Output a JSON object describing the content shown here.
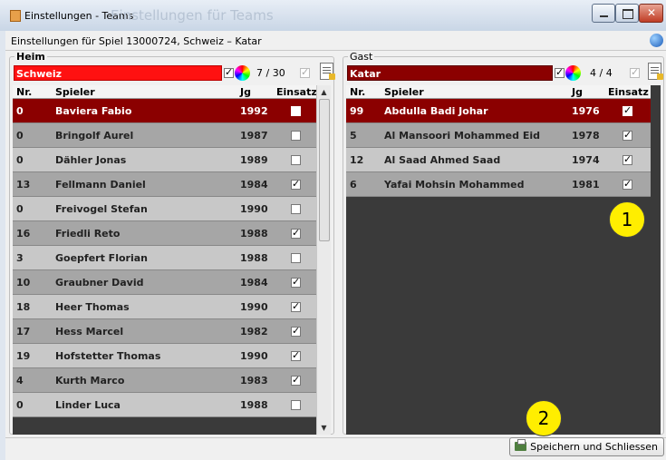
{
  "window": {
    "title": "Einstellungen - Teams",
    "ghost_title": "Einstellungen für Teams"
  },
  "subtitle": "Einstellungen für Spiel 13000724, Schweiz – Katar",
  "home": {
    "legend": "Heim",
    "team": "Schweiz",
    "team_color": "#ff1111",
    "count": "7 / 30",
    "columns": [
      "Nr.",
      "Spieler",
      "Jg",
      "Einsatz"
    ],
    "players": [
      {
        "nr": "0",
        "name": "Baviera Fabio",
        "jg": "1992",
        "einsatz": false,
        "selected": true
      },
      {
        "nr": "0",
        "name": "Bringolf Aurel",
        "jg": "1987",
        "einsatz": false
      },
      {
        "nr": "0",
        "name": "Dähler Jonas",
        "jg": "1989",
        "einsatz": false
      },
      {
        "nr": "13",
        "name": "Fellmann Daniel",
        "jg": "1984",
        "einsatz": true
      },
      {
        "nr": "0",
        "name": "Freivogel Stefan",
        "jg": "1990",
        "einsatz": false
      },
      {
        "nr": "16",
        "name": "Friedli Reto",
        "jg": "1988",
        "einsatz": true
      },
      {
        "nr": "3",
        "name": "Goepfert Florian",
        "jg": "1988",
        "einsatz": false
      },
      {
        "nr": "10",
        "name": "Graubner David",
        "jg": "1984",
        "einsatz": true
      },
      {
        "nr": "18",
        "name": "Heer Thomas",
        "jg": "1990",
        "einsatz": true
      },
      {
        "nr": "17",
        "name": "Hess Marcel",
        "jg": "1982",
        "einsatz": true
      },
      {
        "nr": "19",
        "name": "Hofstetter Thomas",
        "jg": "1990",
        "einsatz": true
      },
      {
        "nr": "4",
        "name": "Kurth Marco",
        "jg": "1983",
        "einsatz": true
      },
      {
        "nr": "0",
        "name": "Linder Luca",
        "jg": "1988",
        "einsatz": false
      }
    ]
  },
  "away": {
    "legend": "Gast",
    "team": "Katar",
    "team_color": "#8b0000",
    "count": "4 / 4",
    "columns": [
      "Nr.",
      "Spieler",
      "Jg",
      "Einsatz"
    ],
    "players": [
      {
        "nr": "99",
        "name": "Abdulla Badi Johar",
        "jg": "1976",
        "einsatz": true,
        "selected": true
      },
      {
        "nr": "5",
        "name": "Al Mansoori Mohammed Eid",
        "jg": "1978",
        "einsatz": true
      },
      {
        "nr": "12",
        "name": "Al Saad Ahmed Saad",
        "jg": "1974",
        "einsatz": true
      },
      {
        "nr": "6",
        "name": "Yafai Mohsin Mohammed",
        "jg": "1981",
        "einsatz": true
      }
    ]
  },
  "markers": [
    "1",
    "2"
  ],
  "save_button": "Speichern und Schliessen"
}
